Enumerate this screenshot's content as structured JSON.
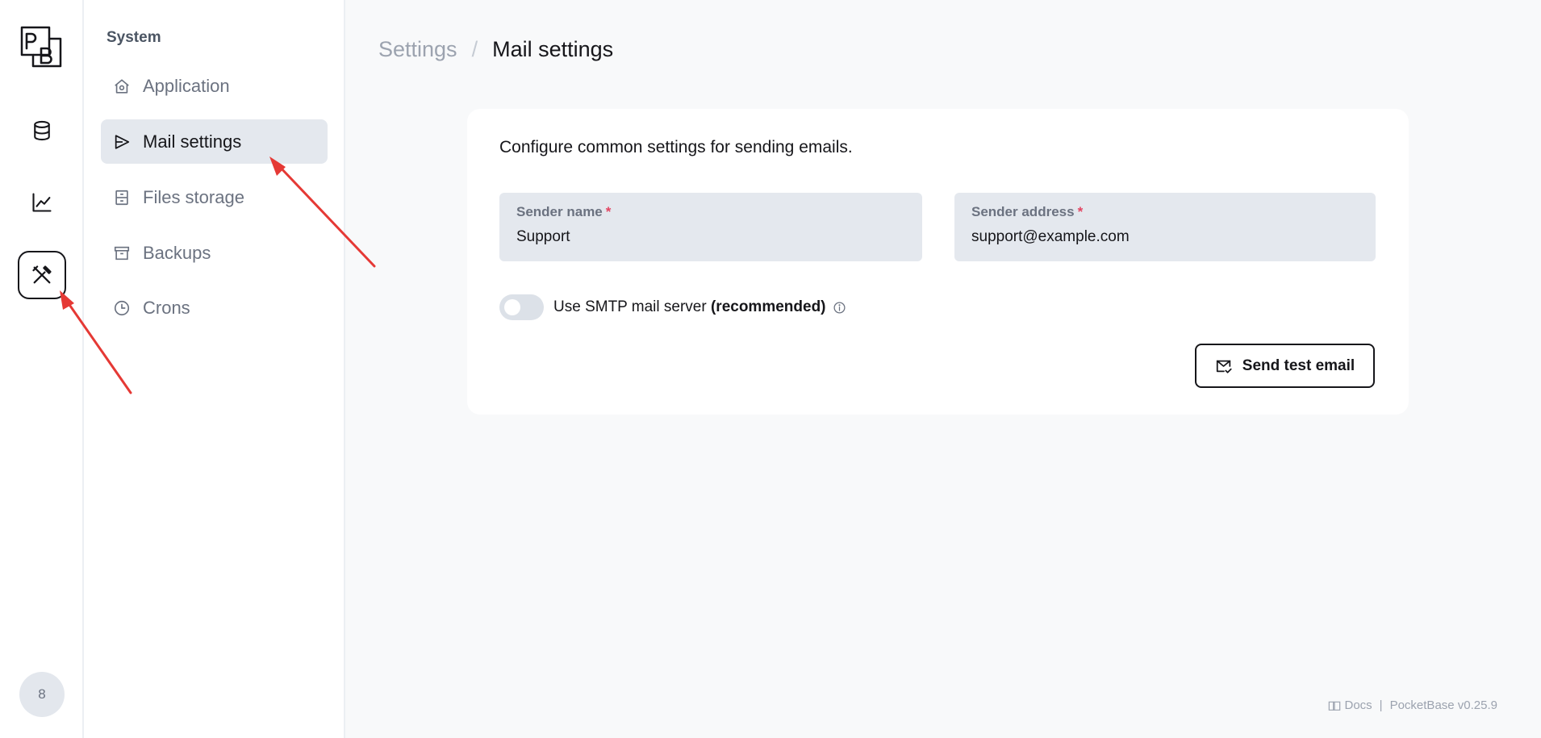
{
  "rail": {
    "logo_text": "PB",
    "items": [
      {
        "name": "collections",
        "icon": "database-icon"
      },
      {
        "name": "logs",
        "icon": "line-chart-icon"
      },
      {
        "name": "settings",
        "icon": "tools-icon",
        "active": true
      }
    ],
    "avatar_text": "8"
  },
  "sidebar": {
    "section_title": "System",
    "items": [
      {
        "label": "Application",
        "icon": "home-settings-icon"
      },
      {
        "label": "Mail settings",
        "icon": "send-plane-icon",
        "active": true
      },
      {
        "label": "Files storage",
        "icon": "file-cabinet-icon"
      },
      {
        "label": "Backups",
        "icon": "archive-icon"
      },
      {
        "label": "Crons",
        "icon": "clock-icon"
      }
    ]
  },
  "breadcrumb": {
    "parent": "Settings",
    "separator": "/",
    "current": "Mail settings"
  },
  "panel": {
    "description": "Configure common settings for sending emails.",
    "sender_name": {
      "label": "Sender name",
      "required_mark": "*",
      "value": "Support"
    },
    "sender_address": {
      "label": "Sender address",
      "required_mark": "*",
      "value": "support@example.com"
    },
    "smtp_toggle": {
      "label_prefix": "Use SMTP mail server",
      "label_bold": "(recommended)",
      "enabled": false
    },
    "send_test_label": "Send test email"
  },
  "footer": {
    "docs_label": "Docs",
    "separator": "|",
    "version": "PocketBase v0.25.9"
  },
  "colors": {
    "accent": "#16161a",
    "active_bg": "#e4e8ee",
    "required": "#e34562",
    "annotation_arrow": "#e53935"
  }
}
